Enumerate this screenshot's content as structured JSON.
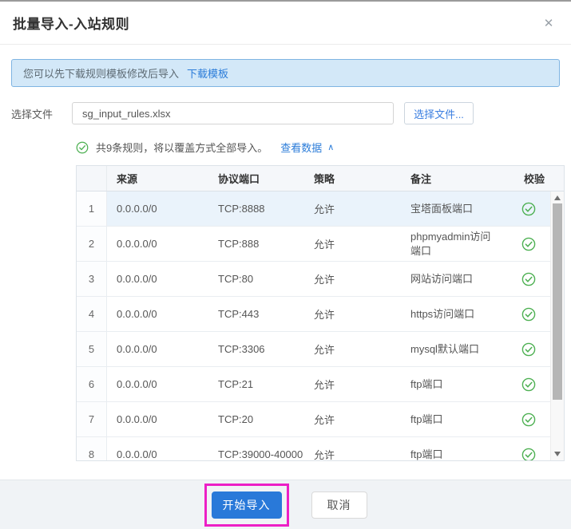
{
  "dialog": {
    "title": "批量导入-入站规则",
    "close_glyph": "✕"
  },
  "banner": {
    "text": "您可以先下载规则模板修改后导入",
    "link_label": "下载模板"
  },
  "file_picker": {
    "label": "选择文件",
    "filename": "sg_input_rules.xlsx",
    "button_label": "选择文件..."
  },
  "notice": {
    "text": "共9条规则，将以覆盖方式全部导入。",
    "link_label": "查看数据",
    "collapse_glyph": "∧"
  },
  "table": {
    "headers": {
      "source": "来源",
      "port": "协议端口",
      "policy": "策略",
      "remark": "备注",
      "check": "校验"
    },
    "rows": [
      {
        "index": "1",
        "source": "0.0.0.0/0",
        "port": "TCP:8888",
        "policy": "允许",
        "remark": "宝塔面板端口"
      },
      {
        "index": "2",
        "source": "0.0.0.0/0",
        "port": "TCP:888",
        "policy": "允许",
        "remark": "phpmyadmin访问端口"
      },
      {
        "index": "3",
        "source": "0.0.0.0/0",
        "port": "TCP:80",
        "policy": "允许",
        "remark": "网站访问端口"
      },
      {
        "index": "4",
        "source": "0.0.0.0/0",
        "port": "TCP:443",
        "policy": "允许",
        "remark": "https访问端口"
      },
      {
        "index": "5",
        "source": "0.0.0.0/0",
        "port": "TCP:3306",
        "policy": "允许",
        "remark": "mysql默认端口"
      },
      {
        "index": "6",
        "source": "0.0.0.0/0",
        "port": "TCP:21",
        "policy": "允许",
        "remark": "ftp端口"
      },
      {
        "index": "7",
        "source": "0.0.0.0/0",
        "port": "TCP:20",
        "policy": "允许",
        "remark": "ftp端口"
      },
      {
        "index": "8",
        "source": "0.0.0.0/0",
        "port": "TCP:39000-40000",
        "policy": "允许",
        "remark": "ftp端口"
      }
    ]
  },
  "footer": {
    "confirm_label": "开始导入",
    "cancel_label": "取消"
  },
  "colors": {
    "primary_button": "#2979d9",
    "annotation_highlight": "#ec1fc6",
    "valid_check_green": "#4db052",
    "banner_background": "#d3e8f8",
    "banner_border": "#7fb4e2",
    "link_blue": "#2b7cd9",
    "row_highlight": "#eaf3fb"
  }
}
